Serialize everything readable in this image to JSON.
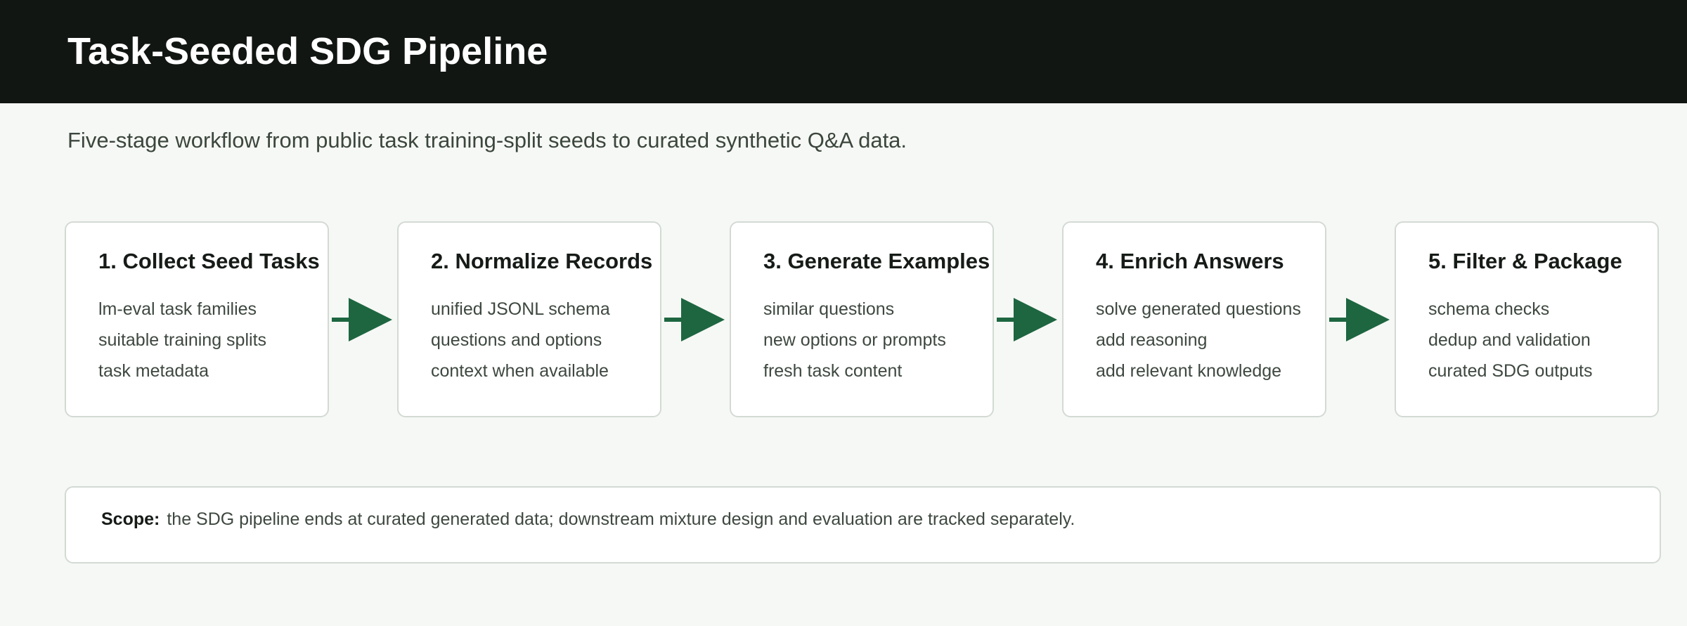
{
  "header": {
    "title": "Task-Seeded SDG Pipeline"
  },
  "subtitle": "Five-stage workflow from public task training-split seeds to curated synthetic Q&A data.",
  "colors": {
    "header_bg": "#121613",
    "page_bg": "#f6f8f5",
    "arrow": "#1d6640",
    "card_border": "#d3dad4"
  },
  "stages": [
    {
      "title": "1. Collect Seed Tasks",
      "items": [
        "lm-eval task families",
        "suitable training splits",
        "task metadata"
      ]
    },
    {
      "title": "2. Normalize Records",
      "items": [
        "unified JSONL schema",
        "questions and options",
        "context when available"
      ]
    },
    {
      "title": "3. Generate Examples",
      "items": [
        "similar questions",
        "new options or prompts",
        "fresh task content"
      ]
    },
    {
      "title": "4. Enrich Answers",
      "items": [
        "solve generated questions",
        "add reasoning",
        "add relevant knowledge"
      ]
    },
    {
      "title": "5. Filter & Package",
      "items": [
        "schema checks",
        "dedup and validation",
        "curated SDG outputs"
      ]
    }
  ],
  "scope": {
    "label": "Scope:",
    "text": "the SDG pipeline ends at curated generated data; downstream mixture design and evaluation are tracked separately."
  }
}
